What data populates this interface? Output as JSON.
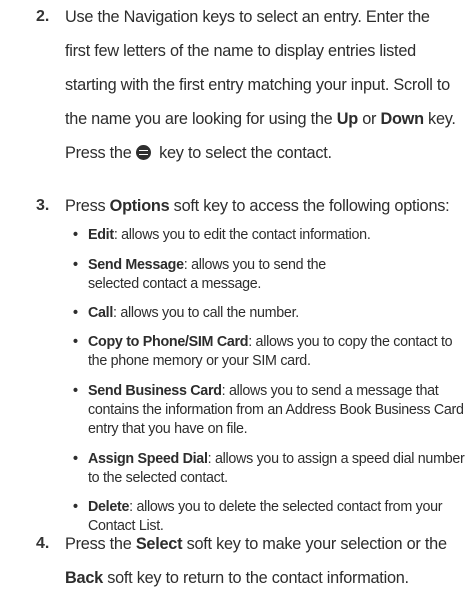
{
  "steps": [
    {
      "number": "2.",
      "text_a": "Use the Navigation keys to select an entry. Enter the first few letters of the name to display entries listed starting with the first entry matching your input. Scroll to the name you are looking for using the ",
      "bold_a": "Up",
      "text_b": " or ",
      "bold_b": "Down",
      "text_c": " key. Press the ",
      "icon": "ok-center-key-icon",
      "text_d": " key to select the contact."
    },
    {
      "number": "3.",
      "text_a": "Press ",
      "bold_a": "Options",
      "text_b": " soft key to access the following options:"
    },
    {
      "number": "4.",
      "text_a": "Press the ",
      "bold_a": "Select",
      "text_b": " soft key to make your selection or the ",
      "bold_b": "Back",
      "text_c": " soft key to return to the contact information."
    }
  ],
  "options": [
    {
      "term": "Edit",
      "desc": ": allows you to edit the contact information."
    },
    {
      "term": "Send Message",
      "desc": ": allows you to send the selected contact a message."
    },
    {
      "term": "Call",
      "desc": ": allows you to call the number."
    },
    {
      "term": "Copy to Phone/SIM Card",
      "desc": ": allows you to copy the contact to the phone memory or your SIM card."
    },
    {
      "term": "Send Business Card",
      "desc": ": allows you to send a message that contains the information from an Address Book Business Card entry that you have on file."
    },
    {
      "term": "Assign Speed Dial",
      "desc": ": allows you to assign a speed dial number to the selected contact."
    },
    {
      "term": "Delete",
      "desc": ": allows you to delete the selected contact from your Contact List."
    }
  ],
  "bullet_char": "•"
}
